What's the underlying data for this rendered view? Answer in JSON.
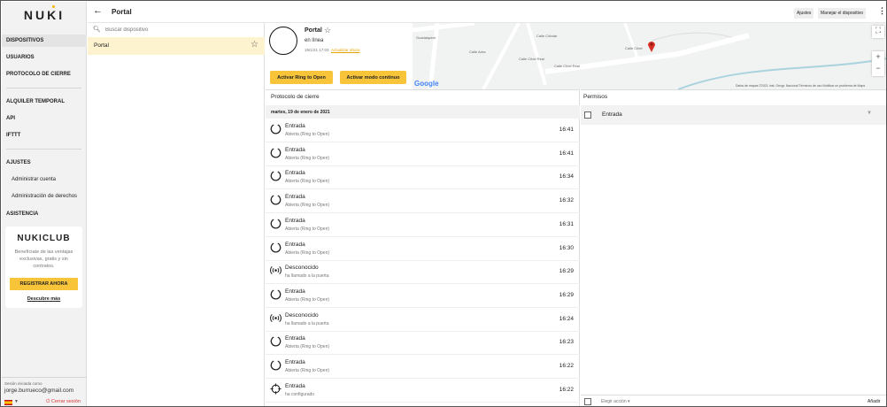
{
  "brand": {
    "logo": "NUKI",
    "accent": "#f8c53a"
  },
  "sidebar": {
    "items": [
      {
        "label": "DISPOSITIVOS"
      },
      {
        "label": "USUARIOS"
      },
      {
        "label": "PROTOCOLO DE CIERRE"
      },
      {
        "label": "ALQUILER TEMPORAL"
      },
      {
        "label": "API"
      },
      {
        "label": "IFTTT"
      },
      {
        "label": "AJUSTES"
      },
      {
        "label": "Administrar cuenta"
      },
      {
        "label": "Administración de derechos"
      },
      {
        "label": "ASISTENCIA"
      }
    ],
    "club": {
      "logo": "NUKICLUB",
      "text": "Benefíciate de las ventajas exclusivas, gratis y sin contratos.",
      "button": "REGISTRAR AHORA",
      "more": "Descubre más"
    },
    "session_label": "Sesión iniciada como",
    "email": "jorge.burrueco@gmail.com",
    "logout": "Cerrar sesión"
  },
  "header": {
    "title": "Portal",
    "settings": "Ajustes",
    "manage": "Manejar el dispositivo",
    "more_icon": "⋮"
  },
  "search": {
    "placeholder": "Buscar dispositivo"
  },
  "list": {
    "items": [
      {
        "name": "Portal"
      }
    ]
  },
  "device": {
    "name": "Portal",
    "status": "en línea",
    "time": "19/1/21 17:03",
    "update": "Actualizar ahora",
    "btn_ring": "Activar Ring to Open",
    "btn_cont": "Activar modo continuo"
  },
  "map": {
    "streets": [
      "Guadalquivir",
      "Calle Adra",
      "Calle Cóbdar",
      "Calle Cíbel Real",
      "Calle Cíbel Real",
      "Calle Cíbel"
    ],
    "google": "Google",
    "attribution": "Datos de mapas ©2021 Inst. Geogr. Nacional   Términos de uso   Notificar un problema de Maps"
  },
  "log": {
    "title": "Protocolo de cierre",
    "date": "martes, 19 de enero de 2021",
    "entries": [
      {
        "name": "Entrada",
        "desc": "Abierta (Ring to Open)",
        "time": "16:41",
        "icon": "open-arc-icon"
      },
      {
        "name": "Entrada",
        "desc": "Abierta (Ring to Open)",
        "time": "16:41",
        "icon": "open-arc-icon"
      },
      {
        "name": "Entrada",
        "desc": "Abierta (Ring to Open)",
        "time": "16:34",
        "icon": "open-arc-icon"
      },
      {
        "name": "Entrada",
        "desc": "Abierta (Ring to Open)",
        "time": "16:32",
        "icon": "open-arc-icon"
      },
      {
        "name": "Entrada",
        "desc": "Abierta (Ring to Open)",
        "time": "16:31",
        "icon": "open-arc-icon"
      },
      {
        "name": "Entrada",
        "desc": "Abierta (Ring to Open)",
        "time": "16:30",
        "icon": "open-arc-icon"
      },
      {
        "name": "Desconocido",
        "desc": "ha llamado a la puerta",
        "time": "16:29",
        "icon": "doorbell-icon"
      },
      {
        "name": "Entrada",
        "desc": "Abierta (Ring to Open)",
        "time": "16:29",
        "icon": "open-arc-icon"
      },
      {
        "name": "Desconocido",
        "desc": "ha llamado a la puerta",
        "time": "16:24",
        "icon": "doorbell-icon"
      },
      {
        "name": "Entrada",
        "desc": "Abierta (Ring to Open)",
        "time": "16:23",
        "icon": "open-arc-icon"
      },
      {
        "name": "Entrada",
        "desc": "Abierta (Ring to Open)",
        "time": "16:22",
        "icon": "open-arc-icon"
      },
      {
        "name": "Entrada",
        "desc": "ha configurado",
        "time": "16:22",
        "icon": "configure-icon"
      }
    ]
  },
  "permissions": {
    "title": "Permisos",
    "rows": [
      {
        "name": "Entrada"
      }
    ],
    "action": "Elegir acción",
    "add": "Añadir"
  }
}
